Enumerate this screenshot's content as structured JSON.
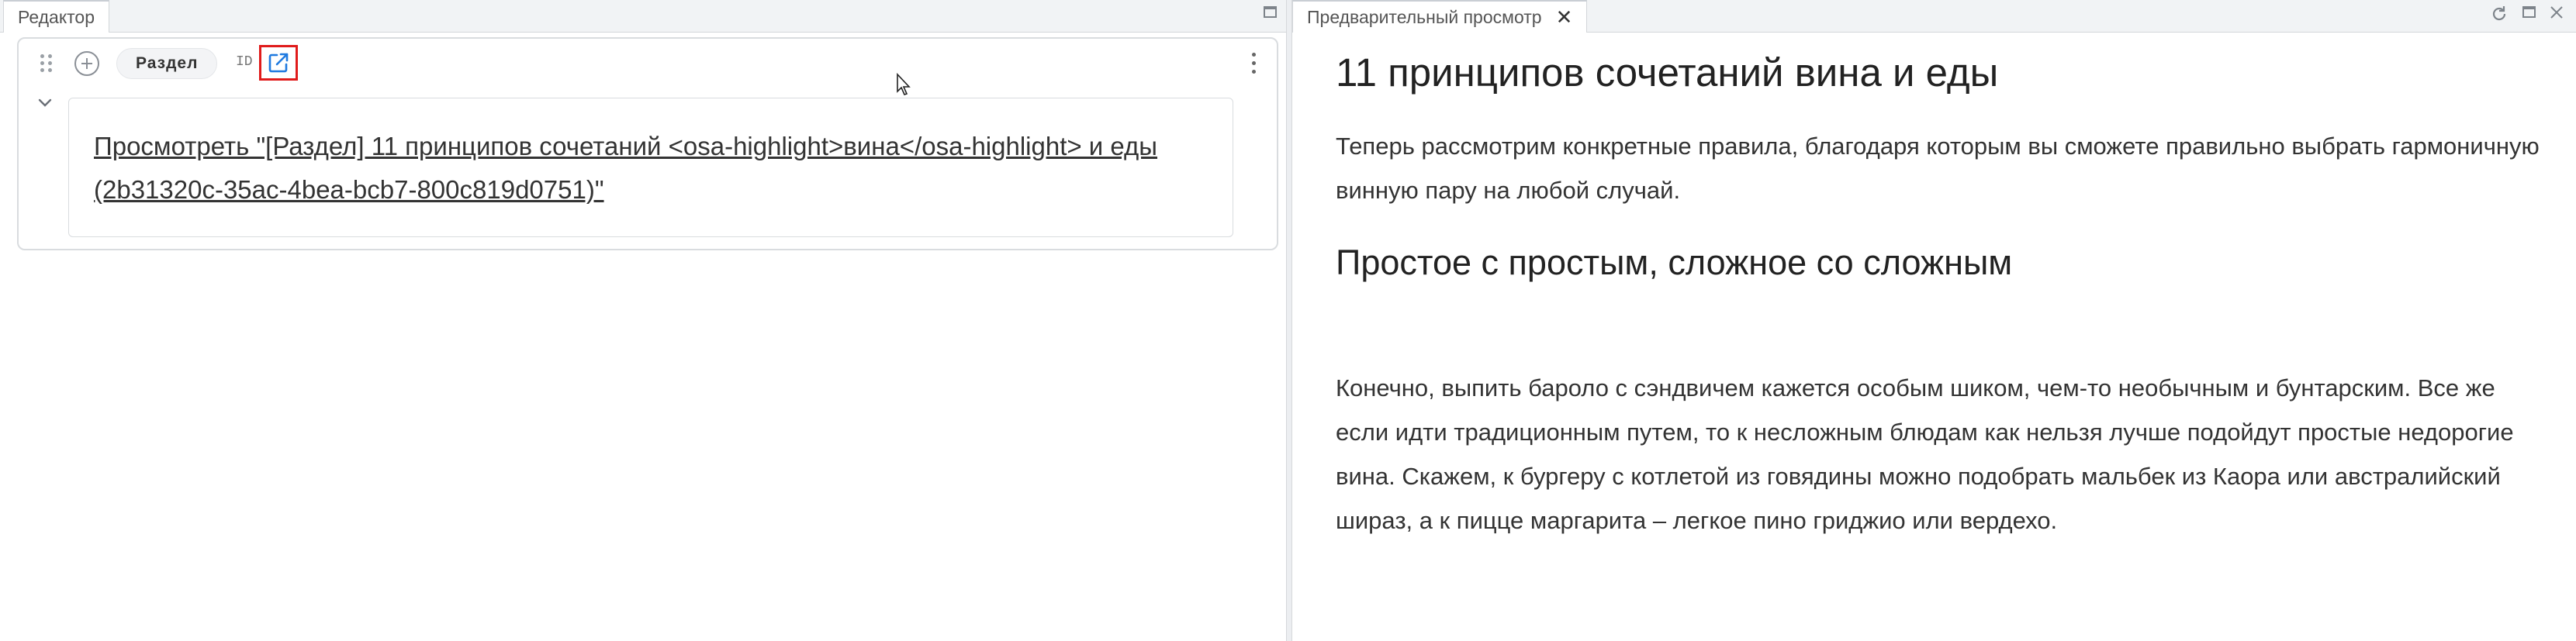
{
  "editor": {
    "tab_title": "Редактор",
    "block": {
      "type_label": "Раздел",
      "id_label": "ID",
      "link_text": "Просмотреть \"[Раздел] 11 принципов сочетаний <osa-highlight>вина</osa-highlight> и еды (2b31320c-35ac-4bea-bcb7-800c819d0751)\""
    }
  },
  "preview": {
    "tab_title": "Предварительный просмотр",
    "close_glyph": "✕",
    "heading": "11 принципов сочетаний вина и еды",
    "paragraph1": "Теперь рассмотрим конкретные правила, благодаря которым вы сможете правильно выбрать гармоничную винную пару на любой случай.",
    "subheading": "Простое с простым, сложное со сложным",
    "paragraph2": "Конечно, выпить бароло с сэндвичем кажется особым шиком, чем-то необычным и бунтарским. Все же если идти традиционным путем, то к несложным блюдам как нельзя лучше подойдут простые недорогие вина. Скажем, к бургеру с котлетой из говядины можно подобрать мальбек из Каора или австралийский шираз, а к пицце маргарита – легкое пино гриджио или вердехо."
  },
  "icons": {
    "drag": "drag-handle-icon",
    "add": "plus-circle-icon",
    "open_link": "external-link-icon",
    "more": "more-vertical-icon",
    "collapse": "chevron-down-icon",
    "refresh": "refresh-icon",
    "maximize": "maximize-icon",
    "close": "close-icon"
  },
  "colors": {
    "highlight_border": "#e01b1b",
    "link_icon": "#1f7ae0"
  }
}
